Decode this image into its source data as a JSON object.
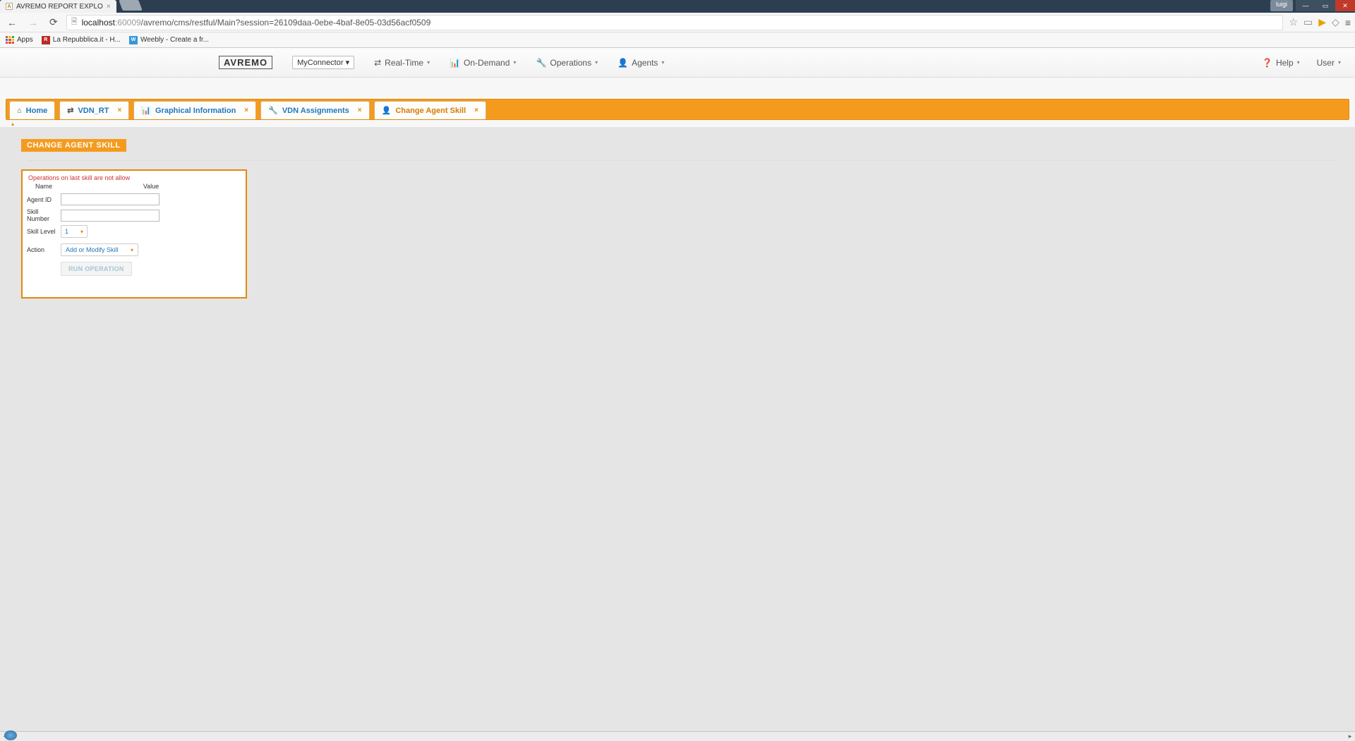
{
  "browser": {
    "tab_title": "AVREMO REPORT EXPLO",
    "url_host": "localhost",
    "url_port": ":60009",
    "url_path": "/avremo/cms/restful/Main?session=26109daa-0ebe-4baf-8e05-03d56acf0509",
    "user_badge": "luigi"
  },
  "bookmarks": {
    "apps": "Apps",
    "items": [
      {
        "label": "La Repubblica.it - H...",
        "icon": "R"
      },
      {
        "label": "Weebly - Create a fr...",
        "icon": "W"
      }
    ]
  },
  "nav": {
    "logo": "AVREMO",
    "connector": "MyConnector ▾",
    "menu": [
      {
        "label": "Real-Time",
        "icon": "⇄"
      },
      {
        "label": "On-Demand",
        "icon": "📊"
      },
      {
        "label": "Operations",
        "icon": "🔧"
      },
      {
        "label": "Agents",
        "icon": "👤"
      }
    ],
    "right": [
      {
        "label": "Help",
        "icon": "❓"
      },
      {
        "label": "User",
        "icon": ""
      }
    ]
  },
  "tabs": [
    {
      "label": "Home",
      "icon": "⌂",
      "closable": false
    },
    {
      "label": "VDN_RT",
      "icon": "⇄",
      "closable": true
    },
    {
      "label": "Graphical Information",
      "icon": "📊",
      "closable": true
    },
    {
      "label": "VDN Assignments",
      "icon": "🔧",
      "closable": true
    },
    {
      "label": "Change Agent Skill",
      "icon": "👤",
      "closable": true,
      "active": true
    }
  ],
  "page": {
    "heading": "CHANGE AGENT SKILL",
    "warning": "Operations on last skill are not allow",
    "col_name": "Name",
    "col_value": "Value",
    "fields": {
      "agent_id_label": "Agent ID",
      "agent_id_value": "",
      "skill_number_label": "Skill Number",
      "skill_number_value": "",
      "skill_level_label": "Skill Level",
      "skill_level_value": "1",
      "action_label": "Action",
      "action_value": "Add or Modify Skill"
    },
    "run_button": "RUN OPERATION"
  }
}
